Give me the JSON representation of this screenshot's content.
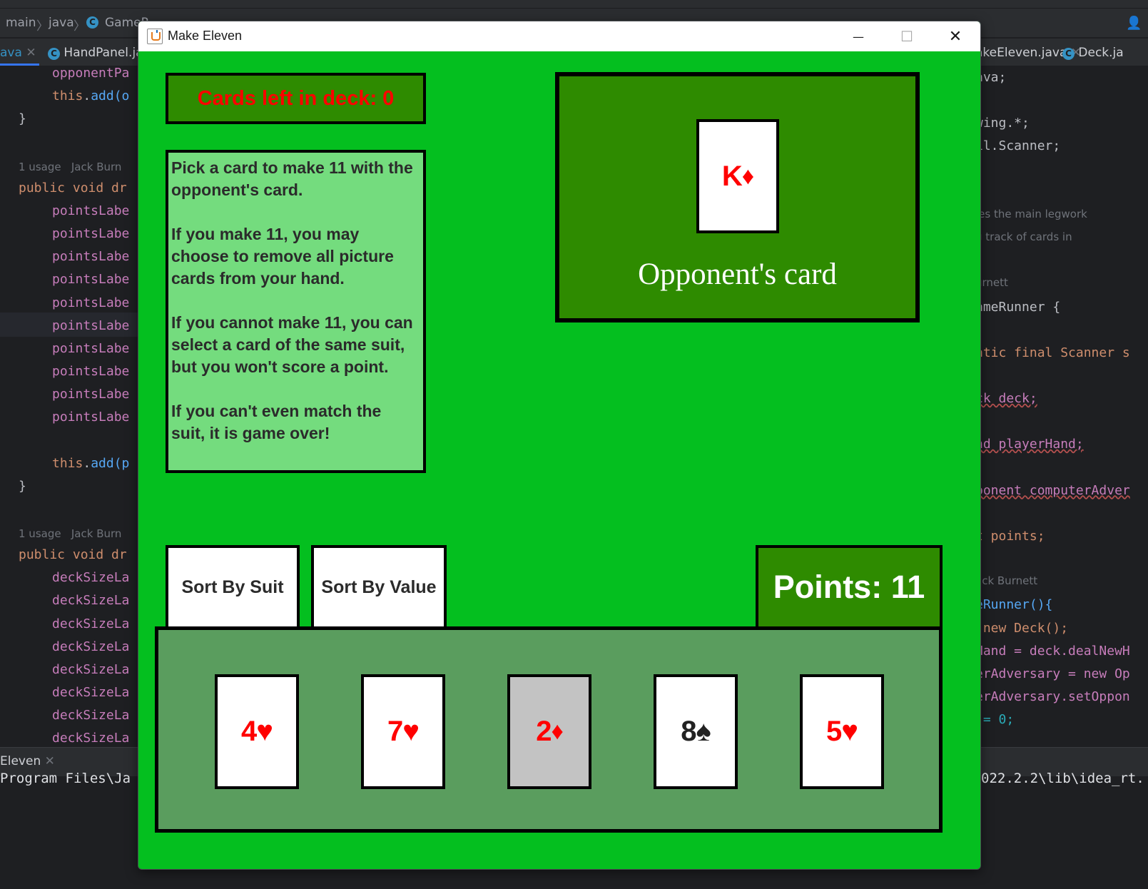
{
  "ide": {
    "breadcrumb": [
      "main",
      "java",
      "GameR"
    ],
    "tabs_left": [
      {
        "label": "ava"
      },
      {
        "label": "HandPanel.ja"
      }
    ],
    "tabs_right": [
      {
        "label": "akeEleven.java"
      },
      {
        "label": "Deck.ja"
      }
    ],
    "code_left": [
      {
        "text": "opponentPa",
        "style": "fld",
        "indent": 1
      },
      {
        "text": "this.add(o",
        "style": "kwfld",
        "indent": 1
      },
      {
        "text": "}",
        "style": "txt",
        "indent": 0
      },
      {
        "text": "",
        "style": "txt",
        "indent": 0
      },
      {
        "text": "1 usage   Jack Burn",
        "style": "hint",
        "indent": 0
      },
      {
        "text": "public void dr",
        "style": "kw",
        "indent": 0
      },
      {
        "text": "pointsLabe",
        "style": "fld",
        "indent": 1
      },
      {
        "text": "pointsLabe",
        "style": "fld",
        "indent": 1
      },
      {
        "text": "pointsLabe",
        "style": "fld",
        "indent": 1
      },
      {
        "text": "pointsLabe",
        "style": "fld",
        "indent": 1
      },
      {
        "text": "pointsLabe",
        "style": "fld",
        "indent": 1
      },
      {
        "text": "pointsLabe",
        "style": "fld",
        "indent": 1
      },
      {
        "text": "pointsLabe",
        "style": "fld",
        "indent": 1
      },
      {
        "text": "pointsLabe",
        "style": "fld",
        "indent": 1
      },
      {
        "text": "pointsLabe",
        "style": "fld",
        "indent": 1
      },
      {
        "text": "pointsLabe",
        "style": "fld",
        "indent": 1
      },
      {
        "text": "",
        "style": "txt",
        "indent": 0
      },
      {
        "text": "this.add(p",
        "style": "kwfld",
        "indent": 1
      },
      {
        "text": "}",
        "style": "txt",
        "indent": 0
      },
      {
        "text": "",
        "style": "txt",
        "indent": 0
      },
      {
        "text": "1 usage   Jack Burn",
        "style": "hint",
        "indent": 0
      },
      {
        "text": "public void dr",
        "style": "kw",
        "indent": 0
      },
      {
        "text": "deckSizeLa",
        "style": "fld",
        "indent": 1
      },
      {
        "text": "deckSizeLa",
        "style": "fld",
        "indent": 1
      },
      {
        "text": "deckSizeLa",
        "style": "fld",
        "indent": 1
      },
      {
        "text": "deckSizeLa",
        "style": "fld",
        "indent": 1
      },
      {
        "text": "deckSizeLa",
        "style": "fld",
        "indent": 1
      },
      {
        "text": "deckSizeLa",
        "style": "fld",
        "indent": 1
      },
      {
        "text": "deckSizeLa",
        "style": "fld",
        "indent": 1
      },
      {
        "text": "deckSizeLa",
        "style": "fld",
        "indent": 1
      }
    ],
    "code_right": [
      {
        "text": "ava;",
        "style": "txt"
      },
      {
        "text": "",
        "style": "txt"
      },
      {
        "text": "wing.*;",
        "style": "txt"
      },
      {
        "text": "il.Scanner;",
        "style": "txt"
      },
      {
        "text": "",
        "style": "txt"
      },
      {
        "text": "",
        "style": "txt"
      },
      {
        "text": "les the main legwork",
        "style": "hint"
      },
      {
        "text": "g track of cards in",
        "style": "hint"
      },
      {
        "text": "",
        "style": "txt"
      },
      {
        "text": "urnett",
        "style": "hint"
      },
      {
        "text": "ameRunner {",
        "style": "txt"
      },
      {
        "text": "",
        "style": "txt"
      },
      {
        "text": "atic final Scanner s",
        "style": "kw"
      },
      {
        "text": "",
        "style": "txt"
      },
      {
        "text": "ck deck;",
        "style": "warn"
      },
      {
        "text": "",
        "style": "txt"
      },
      {
        "text": "nd playerHand;",
        "style": "warn"
      },
      {
        "text": "",
        "style": "txt"
      },
      {
        "text": "ponent computerAdver",
        "style": "warn"
      },
      {
        "text": "",
        "style": "txt"
      },
      {
        "text": "t points;",
        "style": "kw"
      },
      {
        "text": "",
        "style": "txt"
      },
      {
        "text": "ack Burnett",
        "style": "hint"
      },
      {
        "text": "eRunner(){",
        "style": "fn"
      },
      {
        "text": " new Deck();",
        "style": "kw"
      },
      {
        "text": "Hand = deck.dealNewH",
        "style": "fld"
      },
      {
        "text": "erAdversary = new Op",
        "style": "fld"
      },
      {
        "text": "erAdversary.setOppon",
        "style": "fld"
      },
      {
        "text": " = 0;",
        "style": "num"
      }
    ],
    "bottom_tab": "Eleven",
    "console_left": "Program Files\\Ja",
    "console_right": "022.2.2\\lib\\idea_rt."
  },
  "window": {
    "title": "Make Eleven",
    "minimize_symbol": "—",
    "maximize_symbol": "☐",
    "close_symbol": "✕"
  },
  "game": {
    "deck_count": "Cards left in deck: 0",
    "instructions": [
      "Pick a card to make 11 with the opponent's card.",
      "If you make 11, you may choose to remove all picture cards from your hand.",
      "If you cannot make 11, you can select a card of the same suit, but you won't score a point.",
      "If you can't even match the suit, it is game over!"
    ],
    "opponent_card": {
      "rank": "K",
      "suit": "♦",
      "color": "#ff0000"
    },
    "opponent_label": "Opponent's card",
    "sort_suit_label": "Sort By Suit",
    "sort_value_label": "Sort By Value",
    "points": "Points: 11",
    "hand": [
      {
        "rank": "4",
        "suit": "♥",
        "color": "red",
        "selected": false
      },
      {
        "rank": "7",
        "suit": "♥",
        "color": "red",
        "selected": false
      },
      {
        "rank": "2",
        "suit": "♦",
        "color": "red",
        "selected": true
      },
      {
        "rank": "8",
        "suit": "♠",
        "color": "black",
        "selected": false
      },
      {
        "rank": "5",
        "suit": "♥",
        "color": "red",
        "selected": false
      }
    ]
  },
  "colors": {
    "table_green": "#04bf1f",
    "panel_green": "#2e8b00",
    "instructions_bg": "#74dc7e",
    "hand_bg": "#5a9d5e",
    "selected_card": "#c3c3c3",
    "red_suit": "#ff0000"
  }
}
